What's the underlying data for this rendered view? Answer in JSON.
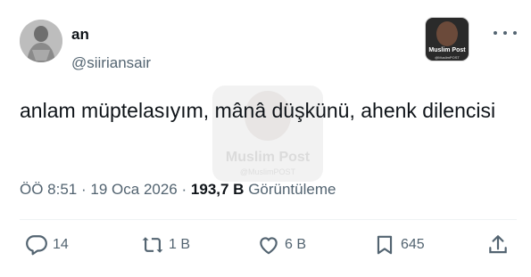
{
  "author": {
    "display_name": "an",
    "handle": "@siiriansair",
    "avatar_icon": "avatar-photo"
  },
  "badge": {
    "title": "Muslim Post",
    "subtitle": "@MuslimPOST"
  },
  "tweet": {
    "text": "anlam müptelasıyım, mânâ düşkünü, ahenk dilencisi"
  },
  "watermark": {
    "title": "Muslim Post",
    "subtitle": "@MuslimPOST"
  },
  "meta": {
    "time": "ÖÖ 8:51",
    "separator1": "·",
    "date": "19 Oca 2026",
    "separator2": "·",
    "views_count": "193,7 B",
    "views_label": "Görüntüleme"
  },
  "actions": {
    "replies": "14",
    "reposts": "1 B",
    "likes": "6 B",
    "bookmarks": "645"
  },
  "colors": {
    "text_primary": "#0f1419",
    "text_secondary": "#536471",
    "divider": "#eff3f4"
  }
}
